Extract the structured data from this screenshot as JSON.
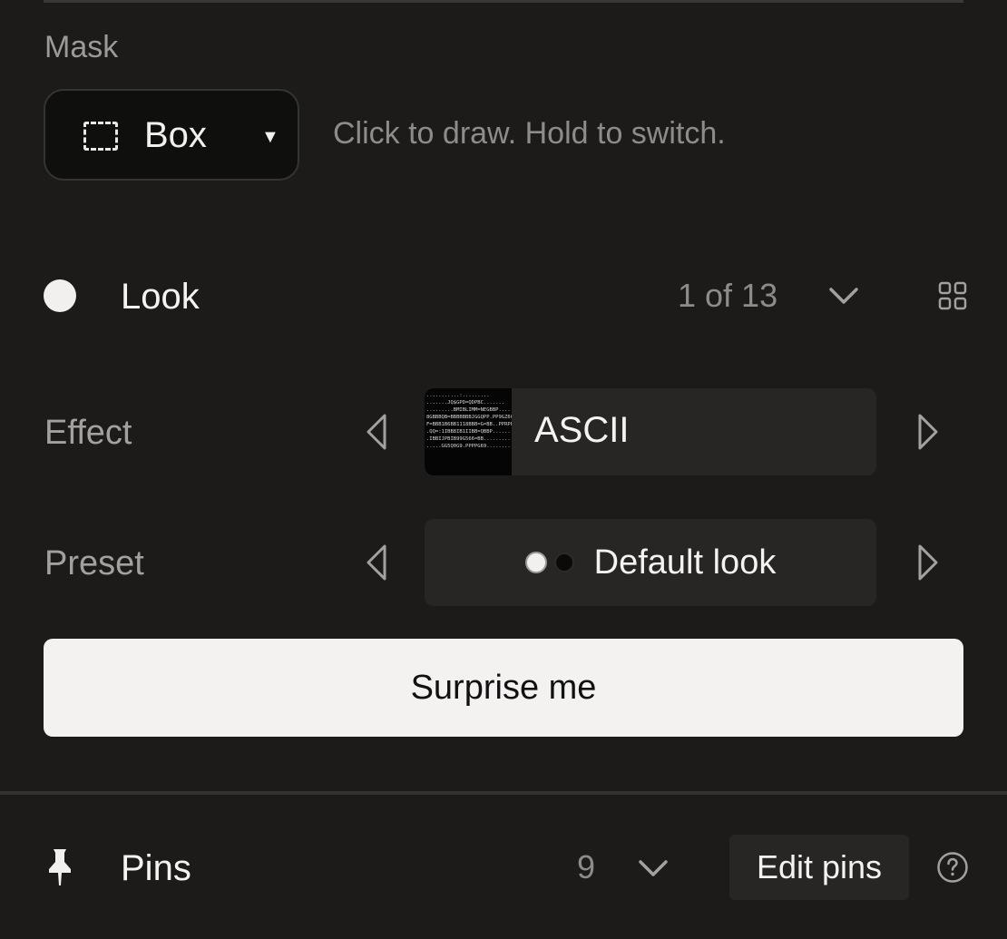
{
  "mask": {
    "label": "Mask",
    "selected": "Box",
    "hint": "Click to draw. Hold to switch.",
    "icon": "dashed-box-icon"
  },
  "look": {
    "label": "Look",
    "count": "1 of 13"
  },
  "effect": {
    "label": "Effect",
    "value": "ASCII",
    "thumbnail_text": "...........:.........\n.......JQ$GPD=QDPBC.......\n.........BMIBLIMM=NEGBBP....\n8GBBBQB=BBBBBBBJGGQPP.PP9GZ66\nF=BBB1B6BB1118BBB=G=BB..PPRPP.\n.QQ=:1IBB8IB1IIBB=QBBP..........\n.IBBIJPBIB99G566=BB.........\n.....GG5Q0G9.PPPPG69.........."
  },
  "preset": {
    "label": "Preset",
    "value": "Default look"
  },
  "surprise": {
    "label": "Surprise me"
  },
  "pins": {
    "label": "Pins",
    "count": "9",
    "edit_label": "Edit pins"
  },
  "colors": {
    "background": "#1c1b1a",
    "field": "#272625",
    "accent_button": "#f3f2f0",
    "muted_text": "#8e8c89"
  }
}
